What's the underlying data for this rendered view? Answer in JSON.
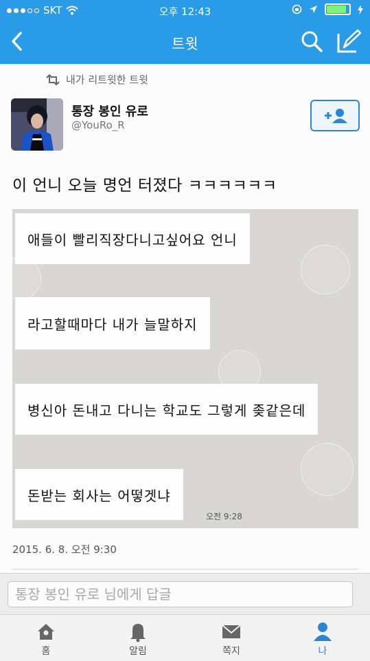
{
  "status_bar": {
    "carrier": "SKT",
    "time": "오후 12:43"
  },
  "nav": {
    "title": "트윗",
    "back_icon": "chevron-left-icon",
    "search_icon": "search-icon",
    "compose_icon": "compose-icon"
  },
  "tweet": {
    "retweet_label": "내가 리트윗한 트윗",
    "user_name": "통장 봉인 유로",
    "user_handle": "@YouRo_R",
    "text": "이 언니 오늘 명언 터졌다 ㅋㅋㅋㅋㅋㅋ",
    "image_chat": [
      "애들이 빨리직장다니고싶어요 언니",
      "라고할때마다 내가 늘말하지",
      "병신아 돈내고 다니는 학교도 그렇게 좆같은데",
      "돈받는 회사는 어떻겟냐"
    ],
    "image_chat_time": "오전 9:28",
    "date": "2015. 6. 8. 오전 9:30"
  },
  "reply": {
    "placeholder": "통장 봉인 유로 님에게 답글"
  },
  "tabs": [
    {
      "label": "홈",
      "icon": "home-icon"
    },
    {
      "label": "알림",
      "icon": "bell-icon"
    },
    {
      "label": "쪽지",
      "icon": "envelope-icon"
    },
    {
      "label": "나",
      "icon": "person-icon"
    }
  ],
  "colors": {
    "header": "#2a9be6",
    "accent": "#2a86d1",
    "battery": "#7df27d"
  }
}
